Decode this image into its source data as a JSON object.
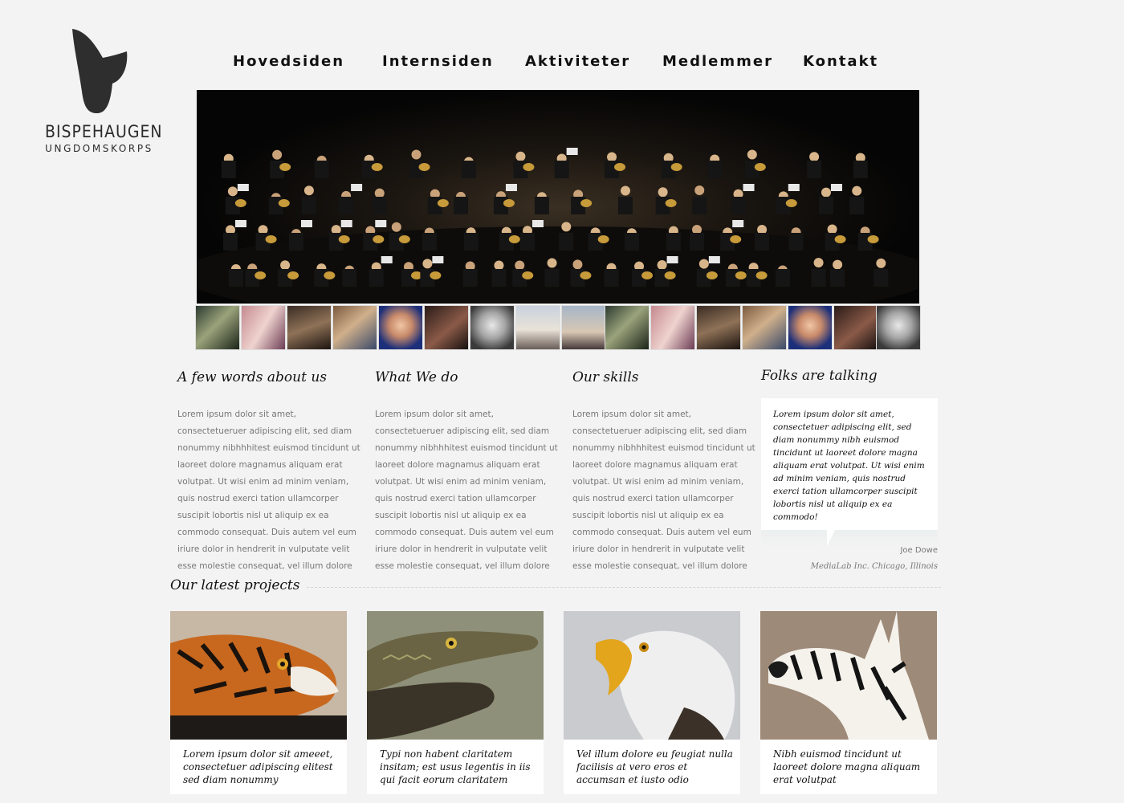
{
  "logo": {
    "name": "BISPEHAUGEN",
    "subtitle": "UNGDOMSKORPS"
  },
  "nav": [
    "Hovedsiden",
    "Internsiden",
    "Aktiviteter",
    "Medlemmer",
    "Kontakt"
  ],
  "columns": [
    {
      "title": "A few words about us",
      "text": "Lorem ipsum dolor sit amet, consectetueruer adipiscing elit, sed diam nonummy nibhhhitest euismod tincidunt ut laoreet dolore magnamus aliquam erat volutpat. Ut wisi enim ad minim veniam, quis nostrud exerci tation ullamcorper suscipit lobortis nisl ut aliquip ex ea commodo consequat. Duis autem vel eum iriure dolor in hendrerit in vulputate velit esse molestie consequat, vel illum dolore eu feugiat nulla facilisis at vero"
    },
    {
      "title": "What We do",
      "text": "Lorem ipsum dolor sit amet, consectetueruer adipiscing elit, sed diam nonummy nibhhhitest euismod tincidunt ut laoreet dolore magnamus aliquam erat volutpat. Ut wisi enim ad minim veniam, quis nostrud exerci tation ullamcorper suscipit lobortis nisl ut aliquip ex ea commodo consequat. Duis autem vel eum iriure dolor in hendrerit in vulputate velit esse molestie consequat, vel illum dolore eu feugiat nulla facilisis at vero"
    },
    {
      "title": "Our skills",
      "text": "Lorem ipsum dolor sit amet, consectetueruer adipiscing elit, sed diam nonummy nibhhhitest euismod tincidunt ut laoreet dolore magnamus aliquam erat volutpat. Ut wisi enim ad minim veniam, quis nostrud exerci tation ullamcorper suscipit lobortis nisl ut aliquip ex ea commodo consequat. Duis autem vel eum iriure dolor in hendrerit in vulputate velit esse molestie consequat, vel illum dolore eu feugiat nulla facilisis at vero"
    }
  ],
  "testimonial": {
    "title": "Folks are talking",
    "quote": "Lorem ipsum dolor sit amet, consectetuer adipiscing elit, sed diam nonummy nibh euismod tincidunt ut laoreet dolore magna aliquam erat volutpat. Ut wisi enim ad minim veniam, quis nostrud exerci tation ullamcorper suscipit lobortis nisl ut aliquip ex ea commodo!",
    "author": "Joe Dowe",
    "company": "MediaLab Inc. Chicago, Illinois"
  },
  "projects": {
    "title": "Our latest projects",
    "items": [
      {
        "caption": "Lorem ipsum dolor sit ameeet, consectetuer adipiscing elitest sed diam nonummy",
        "animal": "tiger"
      },
      {
        "caption": "Typi non habent claritatem insitam; est usus legentis in iis qui facit eorum claritatem",
        "animal": "crocodile"
      },
      {
        "caption": "Vel illum dolore eu feugiat nulla facilisis at vero eros et accumsan et iusto odio",
        "animal": "eagle"
      },
      {
        "caption": "Nibh euismod tincidunt ut laoreet dolore magna aliquam erat volutpat",
        "animal": "zebra"
      }
    ]
  },
  "colors": {
    "background": "#f3f3f3",
    "text": "#111111",
    "muted": "#777777",
    "card": "#ffffff"
  }
}
